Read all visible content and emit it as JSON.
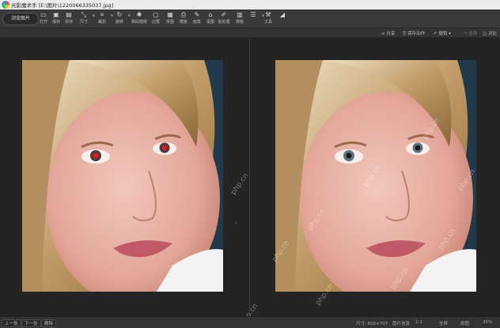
{
  "app": {
    "title": "光影魔术手 [E:\\图片\\1220066335037.jpg]"
  },
  "toolbar": {
    "open_label": "浏览图片",
    "tools": [
      {
        "label": "打开",
        "icon": "folder-icon"
      },
      {
        "label": "保存",
        "icon": "save-icon"
      },
      {
        "label": "另存",
        "icon": "save-as-icon"
      },
      {
        "label": "尺寸",
        "icon": "resize-icon"
      },
      {
        "label": "裁剪",
        "icon": "crop-icon"
      },
      {
        "label": "旋转",
        "icon": "rotate-icon"
      },
      {
        "label": "数码暗房",
        "icon": "darkroom-icon"
      },
      {
        "label": "边框",
        "icon": "frame-icon"
      },
      {
        "label": "拼图",
        "icon": "collage-icon"
      },
      {
        "label": "模板",
        "icon": "template-icon"
      },
      {
        "label": "画笔",
        "icon": "brush-icon"
      },
      {
        "label": "抠图",
        "icon": "cutout-icon"
      },
      {
        "label": "批处理",
        "icon": "batch-icon"
      },
      {
        "label": "排版",
        "icon": "layout-icon"
      },
      {
        "label": "工具",
        "icon": "tools-icon"
      }
    ]
  },
  "actions": {
    "share": "分享",
    "save_step": "保存动作",
    "undo": "撤销",
    "redo": "重做",
    "compare": "对比"
  },
  "status": {
    "prev": "上一张",
    "next": "下一张",
    "delete": "删除",
    "size": "尺寸: 600×707",
    "info": "图片信息",
    "zoom": "35%",
    "fit": "1:1",
    "original": "原图",
    "fullscreen": "全屏"
  },
  "watermark_text": "php.cn"
}
